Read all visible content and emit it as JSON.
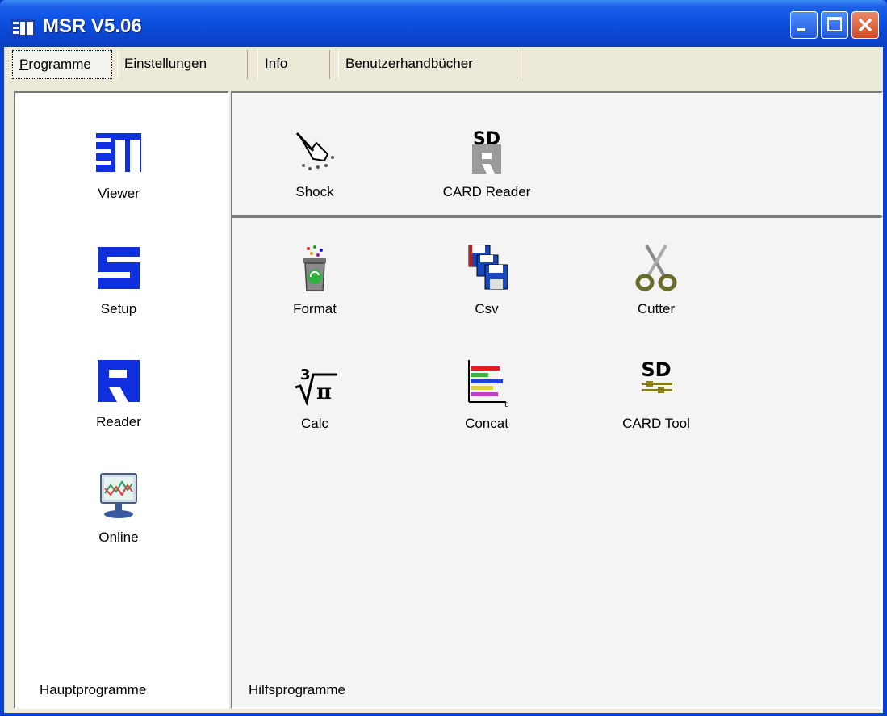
{
  "window": {
    "title": "MSR V5.06",
    "colors": {
      "titlebar": "#0A3FCF",
      "close_button": "#D84A1F",
      "background": "#ECE9D8",
      "panel": "#F4F4F4"
    }
  },
  "menubar": {
    "items": [
      {
        "label": "Programme",
        "underline_char": "P"
      },
      {
        "label": "Einstellungen",
        "underline_char": "E"
      },
      {
        "label": "Info",
        "underline_char": "I"
      },
      {
        "label": "Benutzerhandbücher",
        "underline_char": "B"
      }
    ]
  },
  "haupt": {
    "label": "Hauptprogramme",
    "items": [
      {
        "label": "Viewer",
        "icon": "viewer-icon"
      },
      {
        "label": "Setup",
        "icon": "setup-icon"
      },
      {
        "label": "Reader",
        "icon": "reader-icon"
      },
      {
        "label": "Online",
        "icon": "online-monitor-icon"
      }
    ]
  },
  "top": {
    "items": [
      {
        "label": "Shock",
        "icon": "shock-hand-icon"
      },
      {
        "label": "CARD Reader",
        "icon": "sd-card-reader-icon"
      }
    ]
  },
  "hilfs": {
    "label": "Hilfsprogramme",
    "items": [
      {
        "label": "Format",
        "icon": "trash-recycle-icon"
      },
      {
        "label": "Csv",
        "icon": "floppy-disks-icon"
      },
      {
        "label": "Cutter",
        "icon": "scissors-icon"
      },
      {
        "label": "Calc",
        "icon": "cube-root-pi-icon"
      },
      {
        "label": "Concat",
        "icon": "concat-bars-icon"
      },
      {
        "label": "CARD Tool",
        "icon": "sd-card-tool-icon"
      }
    ]
  }
}
